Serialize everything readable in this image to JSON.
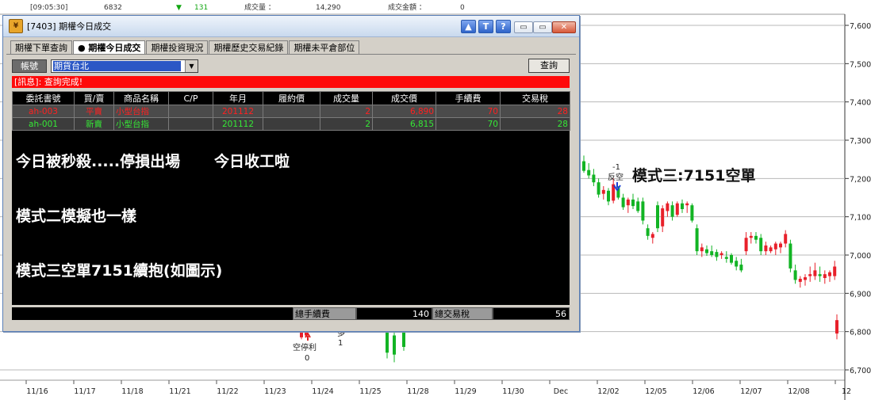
{
  "quote_bar": {
    "time": "[09:05:30]",
    "last": "6832",
    "change_arrow": "▼",
    "change": "131",
    "volume_label": "成交量 ：",
    "volume": "14,290",
    "amount_label": "成交金額 ：",
    "amount": "0"
  },
  "chart_data": {
    "type": "candlestick",
    "x_tick_labels": [
      "11/16",
      "11/17",
      "11/18",
      "11/21",
      "11/22",
      "11/23",
      "11/24",
      "11/25",
      "11/28",
      "11/29",
      "11/30",
      "Dec",
      "12/02",
      "12/05",
      "12/06",
      "12/07",
      "12/08",
      "12"
    ],
    "y_tick_labels": [
      "7,600",
      "7,500",
      "7,400",
      "7,300",
      "7,200",
      "7,100",
      "7,000",
      "6,900",
      "6,800",
      "6,700"
    ],
    "ylim": [
      6680,
      7630
    ],
    "up_color": "#e8202a",
    "down_color": "#12b424",
    "candles": [
      {
        "o": 7245,
        "h": 7260,
        "l": 7215,
        "c": 7220
      },
      {
        "o": 7222,
        "h": 7240,
        "l": 7200,
        "c": 7208
      },
      {
        "o": 7210,
        "h": 7225,
        "l": 7180,
        "c": 7190
      },
      {
        "o": 7190,
        "h": 7200,
        "l": 7150,
        "c": 7158
      },
      {
        "o": 7160,
        "h": 7180,
        "l": 7145,
        "c": 7170
      },
      {
        "o": 7168,
        "h": 7175,
        "l": 7130,
        "c": 7140
      },
      {
        "o": 7142,
        "h": 7200,
        "l": 7135,
        "c": 7185
      },
      {
        "o": 7175,
        "h": 7180,
        "l": 7145,
        "c": 7150
      },
      {
        "o": 7150,
        "h": 7160,
        "l": 7118,
        "c": 7125
      },
      {
        "o": 7130,
        "h": 7150,
        "l": 7110,
        "c": 7145
      },
      {
        "o": 7145,
        "h": 7160,
        "l": 7120,
        "c": 7128
      },
      {
        "o": 7140,
        "h": 7150,
        "l": 7110,
        "c": 7115
      },
      {
        "o": 7140,
        "h": 7150,
        "l": 7080,
        "c": 7090
      },
      {
        "o": 7070,
        "h": 7080,
        "l": 7040,
        "c": 7050
      },
      {
        "o": 7045,
        "h": 7060,
        "l": 7030,
        "c": 7055
      },
      {
        "o": 7130,
        "h": 7140,
        "l": 7060,
        "c": 7070
      },
      {
        "o": 7075,
        "h": 7130,
        "l": 7060,
        "c": 7122
      },
      {
        "o": 7115,
        "h": 7140,
        "l": 7100,
        "c": 7135
      },
      {
        "o": 7130,
        "h": 7140,
        "l": 7090,
        "c": 7100
      },
      {
        "o": 7105,
        "h": 7140,
        "l": 7100,
        "c": 7135
      },
      {
        "o": 7135,
        "h": 7145,
        "l": 7110,
        "c": 7120
      },
      {
        "o": 7130,
        "h": 7140,
        "l": 7110,
        "c": 7135
      },
      {
        "o": 7130,
        "h": 7135,
        "l": 7085,
        "c": 7090
      },
      {
        "o": 7070,
        "h": 7080,
        "l": 7000,
        "c": 7010
      },
      {
        "o": 7010,
        "h": 7030,
        "l": 6995,
        "c": 7020
      },
      {
        "o": 7015,
        "h": 7025,
        "l": 6998,
        "c": 7005
      },
      {
        "o": 7010,
        "h": 7025,
        "l": 6995,
        "c": 7000
      },
      {
        "o": 7008,
        "h": 7015,
        "l": 6985,
        "c": 6995
      },
      {
        "o": 7000,
        "h": 7010,
        "l": 6990,
        "c": 7005
      },
      {
        "o": 6995,
        "h": 7010,
        "l": 6980,
        "c": 6990
      },
      {
        "o": 7000,
        "h": 7005,
        "l": 6975,
        "c": 6980
      },
      {
        "o": 6985,
        "h": 6995,
        "l": 6960,
        "c": 6970
      },
      {
        "o": 6975,
        "h": 6990,
        "l": 6955,
        "c": 6960
      },
      {
        "o": 7010,
        "h": 7060,
        "l": 7000,
        "c": 7045
      },
      {
        "o": 7045,
        "h": 7060,
        "l": 7030,
        "c": 7050
      },
      {
        "o": 7050,
        "h": 7060,
        "l": 7030,
        "c": 7040
      },
      {
        "o": 7045,
        "h": 7055,
        "l": 7000,
        "c": 7010
      },
      {
        "o": 7010,
        "h": 7035,
        "l": 7000,
        "c": 7025
      },
      {
        "o": 7010,
        "h": 7025,
        "l": 7005,
        "c": 7020
      },
      {
        "o": 7015,
        "h": 7035,
        "l": 7000,
        "c": 7030
      },
      {
        "o": 7020,
        "h": 7035,
        "l": 7005,
        "c": 7030
      },
      {
        "o": 7030,
        "h": 7065,
        "l": 7020,
        "c": 7055
      },
      {
        "o": 7030,
        "h": 7040,
        "l": 6955,
        "c": 6965
      },
      {
        "o": 6960,
        "h": 6975,
        "l": 6925,
        "c": 6935
      },
      {
        "o": 6930,
        "h": 6945,
        "l": 6915,
        "c": 6938
      },
      {
        "o": 6935,
        "h": 6950,
        "l": 6920,
        "c": 6942
      },
      {
        "o": 6945,
        "h": 6970,
        "l": 6930,
        "c": 6950
      },
      {
        "o": 6945,
        "h": 6980,
        "l": 6935,
        "c": 6960
      },
      {
        "o": 6950,
        "h": 6970,
        "l": 6930,
        "c": 6945
      },
      {
        "o": 6940,
        "h": 6960,
        "l": 6925,
        "c": 6950
      },
      {
        "o": 6945,
        "h": 6960,
        "l": 6930,
        "c": 6955
      },
      {
        "o": 6945,
        "h": 6985,
        "l": 6935,
        "c": 6970
      },
      {
        "o": 6795,
        "h": 6845,
        "l": 6780,
        "c": 6830
      }
    ],
    "partial_candles": [
      {
        "o": 6785,
        "h": 6810,
        "l": 6780,
        "c": 6800
      },
      {
        "o": 6790,
        "h": 6808,
        "l": 6785,
        "c": 6805
      },
      {
        "o": 6800,
        "h": 6805,
        "l": 6730,
        "c": 6745
      },
      {
        "o": 6790,
        "h": 6800,
        "l": 6720,
        "c": 6740
      },
      {
        "o": 6800,
        "h": 6805,
        "l": 6750,
        "c": 6760
      }
    ],
    "annotations": {
      "short_label_top": "-1",
      "short_label": "反空",
      "mode3_label": "模式三:7151空單",
      "stop_label": "空停利",
      "stop_value": "0",
      "long_label": "多",
      "long_value": "1"
    }
  },
  "window": {
    "title": "[7403] 期權今日成交",
    "icon_glyph": "¥",
    "title_buttons": [
      "▲",
      "T",
      "?"
    ],
    "minimize_glyph": "▭",
    "restore_glyph": "▭",
    "close_glyph": "✕",
    "tabs": [
      "期權下單查詢",
      "● 期權今日成交",
      "期權投資現況",
      "期權歷史交易紀錄",
      "期權未平倉部位"
    ],
    "account_label": "帳號",
    "account_value": "期貨台北",
    "account_arrow": "▼",
    "query_button": "查詢",
    "message": "[訊息]: 查詢完成!",
    "columns": [
      "委託書號",
      "買/賣",
      "商品名稱",
      "C/P",
      "年月",
      "履約價",
      "成交量",
      "成交價",
      "手續費",
      "交易稅"
    ],
    "rows": [
      [
        "ah-003",
        "平賣",
        "小型台指",
        "",
        "201112",
        "",
        "2",
        "6,890",
        "70",
        "28"
      ],
      [
        "ah-001",
        "新賣",
        "小型台指",
        "",
        "201112",
        "",
        "2",
        "6,815",
        "70",
        "28"
      ]
    ],
    "overlay_lines": [
      "今日被秒殺.....停損出場",
      "今日收工啦",
      "模式二模擬也一樣",
      "模式三空單7151續抱(如圖示)"
    ],
    "totals": {
      "fee_label": "總手續費",
      "fee_value": "140",
      "tax_label": "總交易稅",
      "tax_value": "56"
    }
  }
}
